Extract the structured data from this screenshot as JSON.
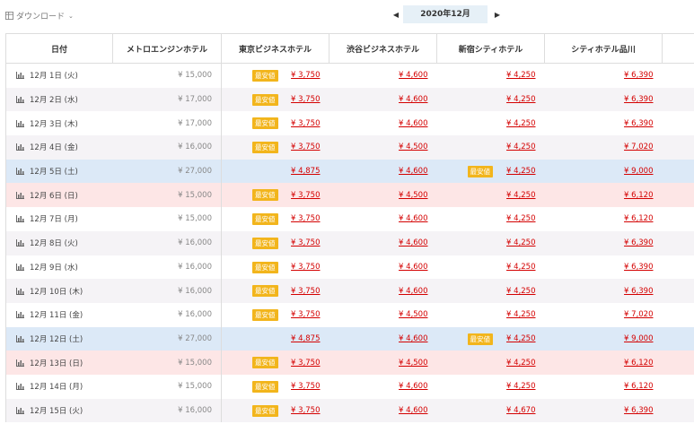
{
  "toolbar": {
    "download_label": "ダウンロード",
    "month": "2020年12月",
    "prev_icon": "triangle-left",
    "next_icon": "triangle-right"
  },
  "colors": {
    "accent_red": "#d40000",
    "badge_bg": "#f2b51c",
    "saturday_row": "#dce9f7",
    "sunday_row": "#fde6e6",
    "alt_row": "#f5f3f6"
  },
  "table": {
    "headers": [
      "日付",
      "メトロエンジンホテル",
      "東京ビジネスホテル",
      "渋谷ビジネスホテル",
      "新宿シティホテル",
      "シティホテル品川"
    ],
    "badge_label": "最安値",
    "rows": [
      {
        "date": "12月 1日 (火)",
        "base": "¥ 15,000",
        "prices": [
          "¥ 3,750",
          "¥ 4,600",
          "¥ 4,250",
          "¥ 6,390"
        ],
        "badge": 0,
        "type": "odd"
      },
      {
        "date": "12月 2日 (水)",
        "base": "¥ 17,000",
        "prices": [
          "¥ 3,750",
          "¥ 4,600",
          "¥ 4,250",
          "¥ 6,390"
        ],
        "badge": 0,
        "type": "even"
      },
      {
        "date": "12月 3日 (木)",
        "base": "¥ 17,000",
        "prices": [
          "¥ 3,750",
          "¥ 4,600",
          "¥ 4,250",
          "¥ 6,390"
        ],
        "badge": 0,
        "type": "odd"
      },
      {
        "date": "12月 4日 (金)",
        "base": "¥ 16,000",
        "prices": [
          "¥ 3,750",
          "¥ 4,500",
          "¥ 4,250",
          "¥ 7,020"
        ],
        "badge": 0,
        "type": "even"
      },
      {
        "date": "12月 5日 (土)",
        "base": "¥ 27,000",
        "prices": [
          "¥ 4,875",
          "¥ 4,600",
          "¥ 4,250",
          "¥ 9,000"
        ],
        "badge": 2,
        "type": "sat"
      },
      {
        "date": "12月 6日 (日)",
        "base": "¥ 15,000",
        "prices": [
          "¥ 3,750",
          "¥ 4,500",
          "¥ 4,250",
          "¥ 6,120"
        ],
        "badge": 0,
        "type": "sun"
      },
      {
        "date": "12月 7日 (月)",
        "base": "¥ 15,000",
        "prices": [
          "¥ 3,750",
          "¥ 4,600",
          "¥ 4,250",
          "¥ 6,120"
        ],
        "badge": 0,
        "type": "odd"
      },
      {
        "date": "12月 8日 (火)",
        "base": "¥ 16,000",
        "prices": [
          "¥ 3,750",
          "¥ 4,600",
          "¥ 4,250",
          "¥ 6,390"
        ],
        "badge": 0,
        "type": "even"
      },
      {
        "date": "12月 9日 (水)",
        "base": "¥ 16,000",
        "prices": [
          "¥ 3,750",
          "¥ 4,600",
          "¥ 4,250",
          "¥ 6,390"
        ],
        "badge": 0,
        "type": "odd"
      },
      {
        "date": "12月 10日 (木)",
        "base": "¥ 16,000",
        "prices": [
          "¥ 3,750",
          "¥ 4,600",
          "¥ 4,250",
          "¥ 6,390"
        ],
        "badge": 0,
        "type": "even"
      },
      {
        "date": "12月 11日 (金)",
        "base": "¥ 16,000",
        "prices": [
          "¥ 3,750",
          "¥ 4,500",
          "¥ 4,250",
          "¥ 7,020"
        ],
        "badge": 0,
        "type": "odd"
      },
      {
        "date": "12月 12日 (土)",
        "base": "¥ 27,000",
        "prices": [
          "¥ 4,875",
          "¥ 4,600",
          "¥ 4,250",
          "¥ 9,000"
        ],
        "badge": 2,
        "type": "sat"
      },
      {
        "date": "12月 13日 (日)",
        "base": "¥ 15,000",
        "prices": [
          "¥ 3,750",
          "¥ 4,500",
          "¥ 4,250",
          "¥ 6,120"
        ],
        "badge": 0,
        "type": "sun"
      },
      {
        "date": "12月 14日 (月)",
        "base": "¥ 15,000",
        "prices": [
          "¥ 3,750",
          "¥ 4,600",
          "¥ 4,250",
          "¥ 6,120"
        ],
        "badge": 0,
        "type": "odd"
      },
      {
        "date": "12月 15日 (火)",
        "base": "¥ 16,000",
        "prices": [
          "¥ 3,750",
          "¥ 4,600",
          "¥ 4,670",
          "¥ 6,390"
        ],
        "badge": 0,
        "type": "even"
      }
    ]
  }
}
